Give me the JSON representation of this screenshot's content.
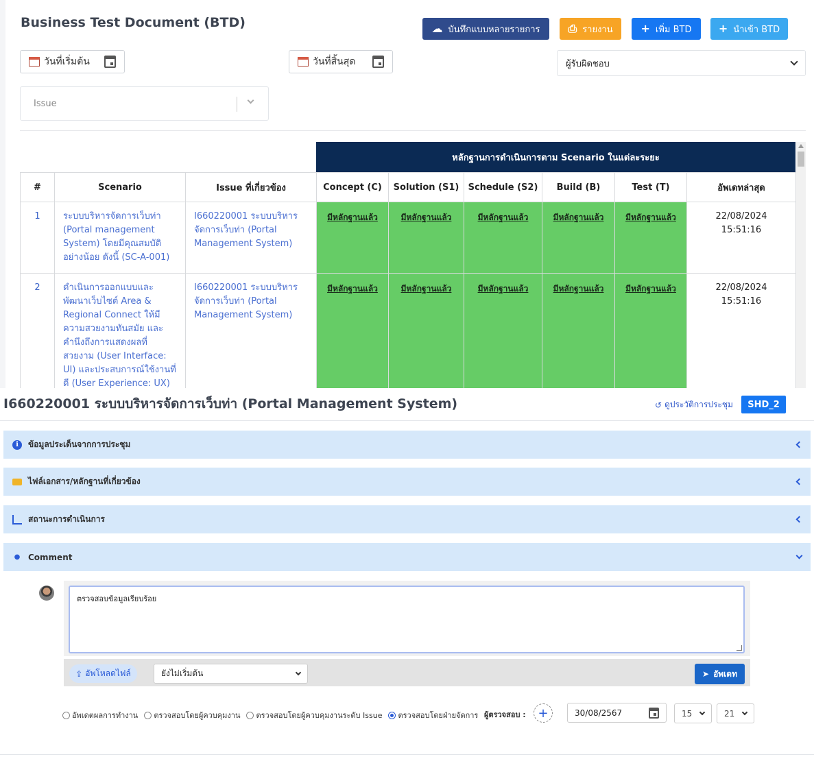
{
  "header": {
    "title": "Business Test Document (BTD)",
    "save_multi_label": "บันทึกแบบหลายรายการ",
    "report_label": "รายงาน",
    "add_label": "เพิ่ม BTD",
    "import_label": "นำเข้า BTD"
  },
  "filters": {
    "start_date_placeholder": "วันที่เริ่มต้น",
    "end_date_placeholder": "วันที่สิ้นสุด",
    "fixer_placeholder": "ผู้รับผิดชอบ",
    "issue_placeholder": "Issue"
  },
  "table": {
    "group_header": "หลักฐานการดำเนินการตาม Scenario ในแต่ละระยะ",
    "columns": [
      "#",
      "Scenario",
      "Issue ที่เกี่ยวข้อง",
      "Concept (C)",
      "Solution (S1)",
      "Schedule (S2)",
      "Build (B)",
      "Test (T)",
      "อัพเดทล่าสุด"
    ],
    "rows": [
      {
        "num": "1",
        "scenario": "ระบบบริหารจัดการเว็บท่า (Portal management System) โดยมีคุณสมบัติอย่างน้อย ดังนี้ (SC-A-001)",
        "issue": "I660220001 ระบบบริหารจัดการเว็บท่า (Portal Management System)",
        "evidence": [
          "มีหลักฐานแล้ว",
          "มีหลักฐานแล้ว",
          "มีหลักฐานแล้ว",
          "มีหลักฐานแล้ว",
          "มีหลักฐานแล้ว"
        ],
        "updated": "22/08/2024 15:51:16"
      },
      {
        "num": "2",
        "scenario": "ดำเนินการออกแบบและพัฒนาเว็บไซต์ Area & Regional Connect ให้มีความสวยงามทันสมัย และคำนึงถึงการแสดงผลที่สวยงาม (User Interface: UI) และประสบการณ์ใช้งานที่ดี (User Experience: UX) ซึ่งจะต้องประกอบไปด้วยข้อมูล",
        "issue": "I660220001 ระบบบริหารจัดการเว็บท่า (Portal Management System)",
        "evidence": [
          "มีหลักฐานแล้ว",
          "มีหลักฐานแล้ว",
          "มีหลักฐานแล้ว",
          "มีหลักฐานแล้ว",
          "มีหลักฐานแล้ว"
        ],
        "updated": "22/08/2024 15:51:16"
      }
    ]
  },
  "issue_panel": {
    "title": "I660220001 ระบบบริหารจัดการเว็บท่า (Portal Management System)",
    "history_link": "ดูประวัติการประชุม",
    "badge": "SHD_2",
    "sections": [
      {
        "label": "ข้อมูลประเด็นจากการประชุม",
        "icon": "info-icon"
      },
      {
        "label": "ไฟล์เอกสาร/หลักฐานที่เกี่ยวข้อง",
        "icon": "folder-icon"
      },
      {
        "label": "สถานะการดำเนินการ",
        "icon": "chart-icon"
      },
      {
        "label": "Comment",
        "icon": "comment-icon"
      }
    ],
    "comment_text": "ตรวจสอบข้อมูลเรียบร้อย",
    "upload_label": "อัพโหลดไฟล์",
    "status_value": "ยังไม่เริ่มต้น",
    "update_label": "อัพเดท",
    "radios": [
      {
        "label": "อัพเดตผลการทำงาน",
        "checked": false
      },
      {
        "label": "ตรวจสอบโดยผู้ควบคุมงาน",
        "checked": false
      },
      {
        "label": "ตรวจสอบโดยผู้ควบคุมงานระดับ Issue",
        "checked": false
      },
      {
        "label": "ตรวจสอบโดยฝ่ายจัดการ",
        "checked": true
      }
    ],
    "reviewer_label": "ผู้ตรวจสอบ :",
    "date_value": "30/08/2567",
    "hour_value": "15",
    "minute_value": "21"
  },
  "colors": {
    "evidence_green": "#66cc66",
    "header_navy": "#0b2a54",
    "accent_blue": "#1677f2"
  }
}
